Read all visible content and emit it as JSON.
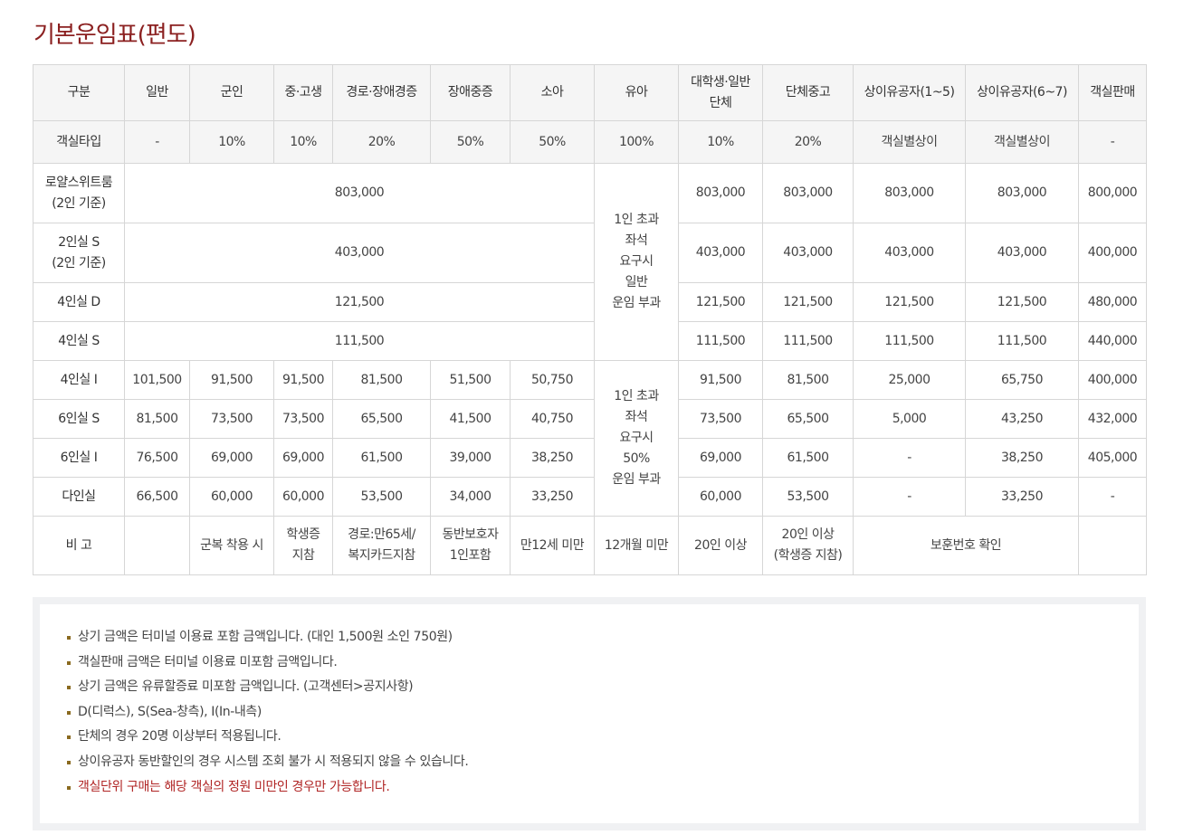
{
  "page_title": "기본운임표(편도)",
  "table": {
    "headers": [
      "구분",
      "일반",
      "군인",
      "중·고생",
      "경로·장애경증",
      "장애중증",
      "소아",
      "유아",
      "대학생·일반\n단체",
      "단체중고",
      "상이유공자(1~5)",
      "상이유공자(6~7)",
      "객실판매"
    ],
    "type_row": [
      "객실타입",
      "-",
      "10%",
      "10%",
      "20%",
      "50%",
      "50%",
      "100%",
      "10%",
      "20%",
      "객실별상이",
      "객실별상이",
      "-"
    ],
    "room_rows_merged": [
      {
        "label": "로얄스위트룸\n(2인 기준)",
        "merged": "803,000",
        "cols": [
          "803,000",
          "803,000",
          "803,000",
          "803,000",
          "800,000"
        ]
      },
      {
        "label": "2인실 S\n(2인 기준)",
        "merged": "403,000",
        "cols": [
          "403,000",
          "403,000",
          "403,000",
          "403,000",
          "400,000"
        ]
      },
      {
        "label": "4인실 D",
        "merged": "121,500",
        "cols": [
          "121,500",
          "121,500",
          "121,500",
          "121,500",
          "480,000"
        ]
      },
      {
        "label": "4인실 S",
        "merged": "111,500",
        "cols": [
          "111,500",
          "111,500",
          "111,500",
          "111,500",
          "440,000"
        ]
      }
    ],
    "infant_note_1": "1인 초과\n좌석\n요구시\n일반\n운임 부과",
    "room_rows_split": [
      {
        "label": "4인실 I",
        "cols": [
          "101,500",
          "91,500",
          "91,500",
          "81,500",
          "51,500",
          "50,750"
        ],
        "cols2": [
          "91,500",
          "81,500",
          "25,000",
          "65,750",
          "400,000"
        ]
      },
      {
        "label": "6인실 S",
        "cols": [
          "81,500",
          "73,500",
          "73,500",
          "65,500",
          "41,500",
          "40,750"
        ],
        "cols2": [
          "73,500",
          "65,500",
          "5,000",
          "43,250",
          "432,000"
        ]
      },
      {
        "label": "6인실 I",
        "cols": [
          "76,500",
          "69,000",
          "69,000",
          "61,500",
          "39,000",
          "38,250"
        ],
        "cols2": [
          "69,000",
          "61,500",
          "-",
          "38,250",
          "405,000"
        ]
      },
      {
        "label": "다인실",
        "cols": [
          "66,500",
          "60,000",
          "60,000",
          "53,500",
          "34,000",
          "33,250"
        ],
        "cols2": [
          "60,000",
          "53,500",
          "-",
          "33,250",
          "-"
        ]
      }
    ],
    "infant_note_2": "1인 초과\n좌석\n요구시\n50%\n운임 부과",
    "remarks": {
      "label": "비 고",
      "general": "",
      "military": "군복 착용 시",
      "student": "학생증\n지참",
      "senior": "경로:만65세/\n복지카드지참",
      "disabled_severe": "동반보호자\n1인포함",
      "child": "만12세 미만",
      "infant": "12개월 미만",
      "group": "20인 이상",
      "group_student": "20인 이상\n(학생증 지참)",
      "veteran": "보훈번호 확인",
      "room_sale": ""
    }
  },
  "notes": [
    {
      "text": "상기 금액은 터미널 이용료 포함 금액입니다. (대인 1,500원 소인 750원)",
      "highlight": false
    },
    {
      "text": "객실판매 금액은 터미널 이용료 미포함 금액입니다.",
      "highlight": false
    },
    {
      "text": "상기 금액은 유류할증료 미포함 금액입니다. (고객센터>공지사항)",
      "highlight": false
    },
    {
      "text": "D(디럭스), S(Sea-창측), I(In-내측)",
      "highlight": false
    },
    {
      "text": "단체의 경우 20명 이상부터 적용됩니다.",
      "highlight": false
    },
    {
      "text": "상이유공자 동반할인의 경우 시스템 조회 불가 시 적용되지 않을 수 있습니다.",
      "highlight": false
    },
    {
      "text": "객실단위 구매는 해당 객실의 정원 미만인 경우만 가능합니다.",
      "highlight": true
    }
  ],
  "colors": {
    "title": "#8b2020",
    "header_bg": "#f5f5f5",
    "border": "#d6d6d6",
    "bullet": "#8a6a1f",
    "highlight": "#b02424",
    "notes_bg": "#f0f1f3"
  }
}
